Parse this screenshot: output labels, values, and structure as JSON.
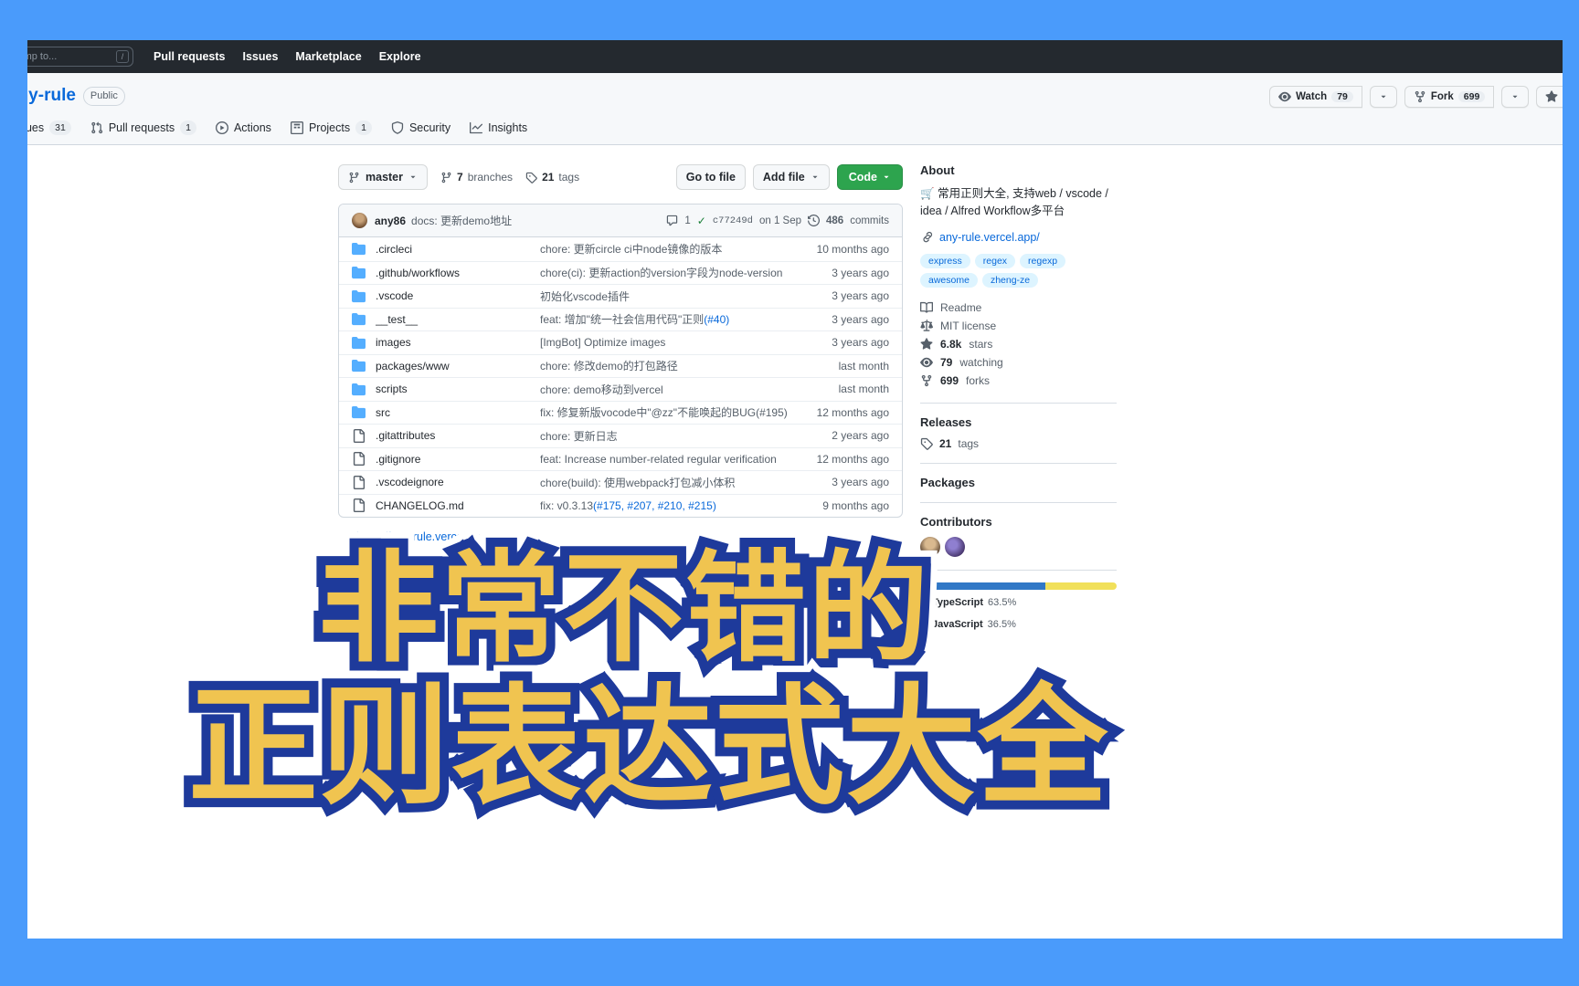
{
  "browser": {
    "frame_color": "#4a9bfb"
  },
  "topnav": {
    "search_placeholder": "h or jump to...",
    "slash_key": "/",
    "links": [
      {
        "label": "Pull requests"
      },
      {
        "label": "Issues"
      },
      {
        "label": "Marketplace"
      },
      {
        "label": "Explore"
      }
    ]
  },
  "repo": {
    "name": "any-rule",
    "visibility": "Public",
    "actions": {
      "watch_label": "Watch",
      "watch_count": "79",
      "fork_label": "Fork",
      "fork_count": "699",
      "star_label": "S"
    },
    "tabs": [
      {
        "label": "Issues",
        "count": "31",
        "icon": "issue-opened-icon"
      },
      {
        "label": "Pull requests",
        "count": "1",
        "icon": "git-pull-request-icon"
      },
      {
        "label": "Actions",
        "count": "",
        "icon": "play-icon"
      },
      {
        "label": "Projects",
        "count": "1",
        "icon": "table-icon"
      },
      {
        "label": "Security",
        "count": "",
        "icon": "shield-icon"
      },
      {
        "label": "Insights",
        "count": "",
        "icon": "graph-icon"
      }
    ]
  },
  "branchbar": {
    "branch": "master",
    "branches_count": "7",
    "branches_label": "branches",
    "tags_count": "21",
    "tags_label": "tags",
    "goto_file": "Go to file",
    "add_file": "Add file",
    "code": "Code"
  },
  "commitbar": {
    "author": "any86",
    "message": "docs: 更新demo地址",
    "comments": "1",
    "sha": "c77249d",
    "date": "on 1 Sep",
    "commits_count": "486",
    "commits_label": "commits"
  },
  "files": [
    {
      "type": "dir",
      "name": ".circleci",
      "message": "chore: 更新circle ci中node镜像的版本",
      "age": "10 months ago"
    },
    {
      "type": "dir",
      "name": ".github/workflows",
      "message": "chore(ci): 更新action的version字段为node-version",
      "age": "3 years ago"
    },
    {
      "type": "dir",
      "name": ".vscode",
      "message": "初始化vscode插件",
      "age": "3 years ago"
    },
    {
      "type": "dir",
      "name": "__test__",
      "message": "feat: 增加\"统一社会信用代码\"正则",
      "issue": "(#40)",
      "age": "3 years ago"
    },
    {
      "type": "dir",
      "name": "images",
      "message": "[ImgBot] Optimize images",
      "age": "3 years ago"
    },
    {
      "type": "dir",
      "name": "packages/www",
      "message": "chore: 修改demo的打包路径",
      "age": "last month"
    },
    {
      "type": "dir",
      "name": "scripts",
      "message": "chore: demo移动到vercel",
      "age": "last month"
    },
    {
      "type": "dir",
      "name": "src",
      "message": "fix: 修复新版vocode中\"@zz\"不能唤起的BUG(#195)",
      "age": "12 months ago"
    },
    {
      "type": "file",
      "name": ".gitattributes",
      "message": "chore: 更新日志",
      "age": "2 years ago"
    },
    {
      "type": "file",
      "name": ".gitignore",
      "message": "feat: Increase number-related regular verification",
      "age": "12 months ago"
    },
    {
      "type": "file",
      "name": ".vscodeignore",
      "message": "chore(build): 使用webpack打包减小体积",
      "age": "3 years ago"
    },
    {
      "type": "file",
      "name": "CHANGELOG.md",
      "message": "fix: v0.3.13",
      "issue": "(#175, #207, #210, #215)",
      "age": "9 months ago"
    }
  ],
  "readme": {
    "url": "https://any-rule.vercel.app/"
  },
  "about": {
    "title": "About",
    "description": "常用正则大全, 支持web / vscode / idea / Alfred Workflow多平台",
    "homepage": "any-rule.vercel.app/",
    "topics": [
      "express",
      "regex",
      "regexp",
      "awesome",
      "zheng-ze"
    ],
    "meta": [
      {
        "icon": "book-icon",
        "label": "Readme",
        "strong": ""
      },
      {
        "icon": "law-icon",
        "label": "MIT license",
        "strong": ""
      },
      {
        "icon": "star-icon",
        "label": "stars",
        "strong": "6.8k"
      },
      {
        "icon": "eye-icon",
        "label": "watching",
        "strong": "79"
      },
      {
        "icon": "fork-icon",
        "label": "forks",
        "strong": "699"
      }
    ],
    "releases_title": "Releases",
    "releases_value": "21",
    "releases_label": "tags",
    "packages_title": "Packages",
    "contributors_title": "Contributors"
  },
  "languages": {
    "items": [
      {
        "name": "TypeScript",
        "pct": "63.5%",
        "value": 63.5,
        "color": "#3178c6"
      },
      {
        "name": "JavaScript",
        "pct": "36.5%",
        "value": 36.5,
        "color": "#f1e05a"
      }
    ]
  },
  "overlay": {
    "line1": "非常不错的",
    "line2": "正则表达式大全",
    "fill_color": "#f0c450",
    "stroke_color": "#1e3a9b"
  }
}
